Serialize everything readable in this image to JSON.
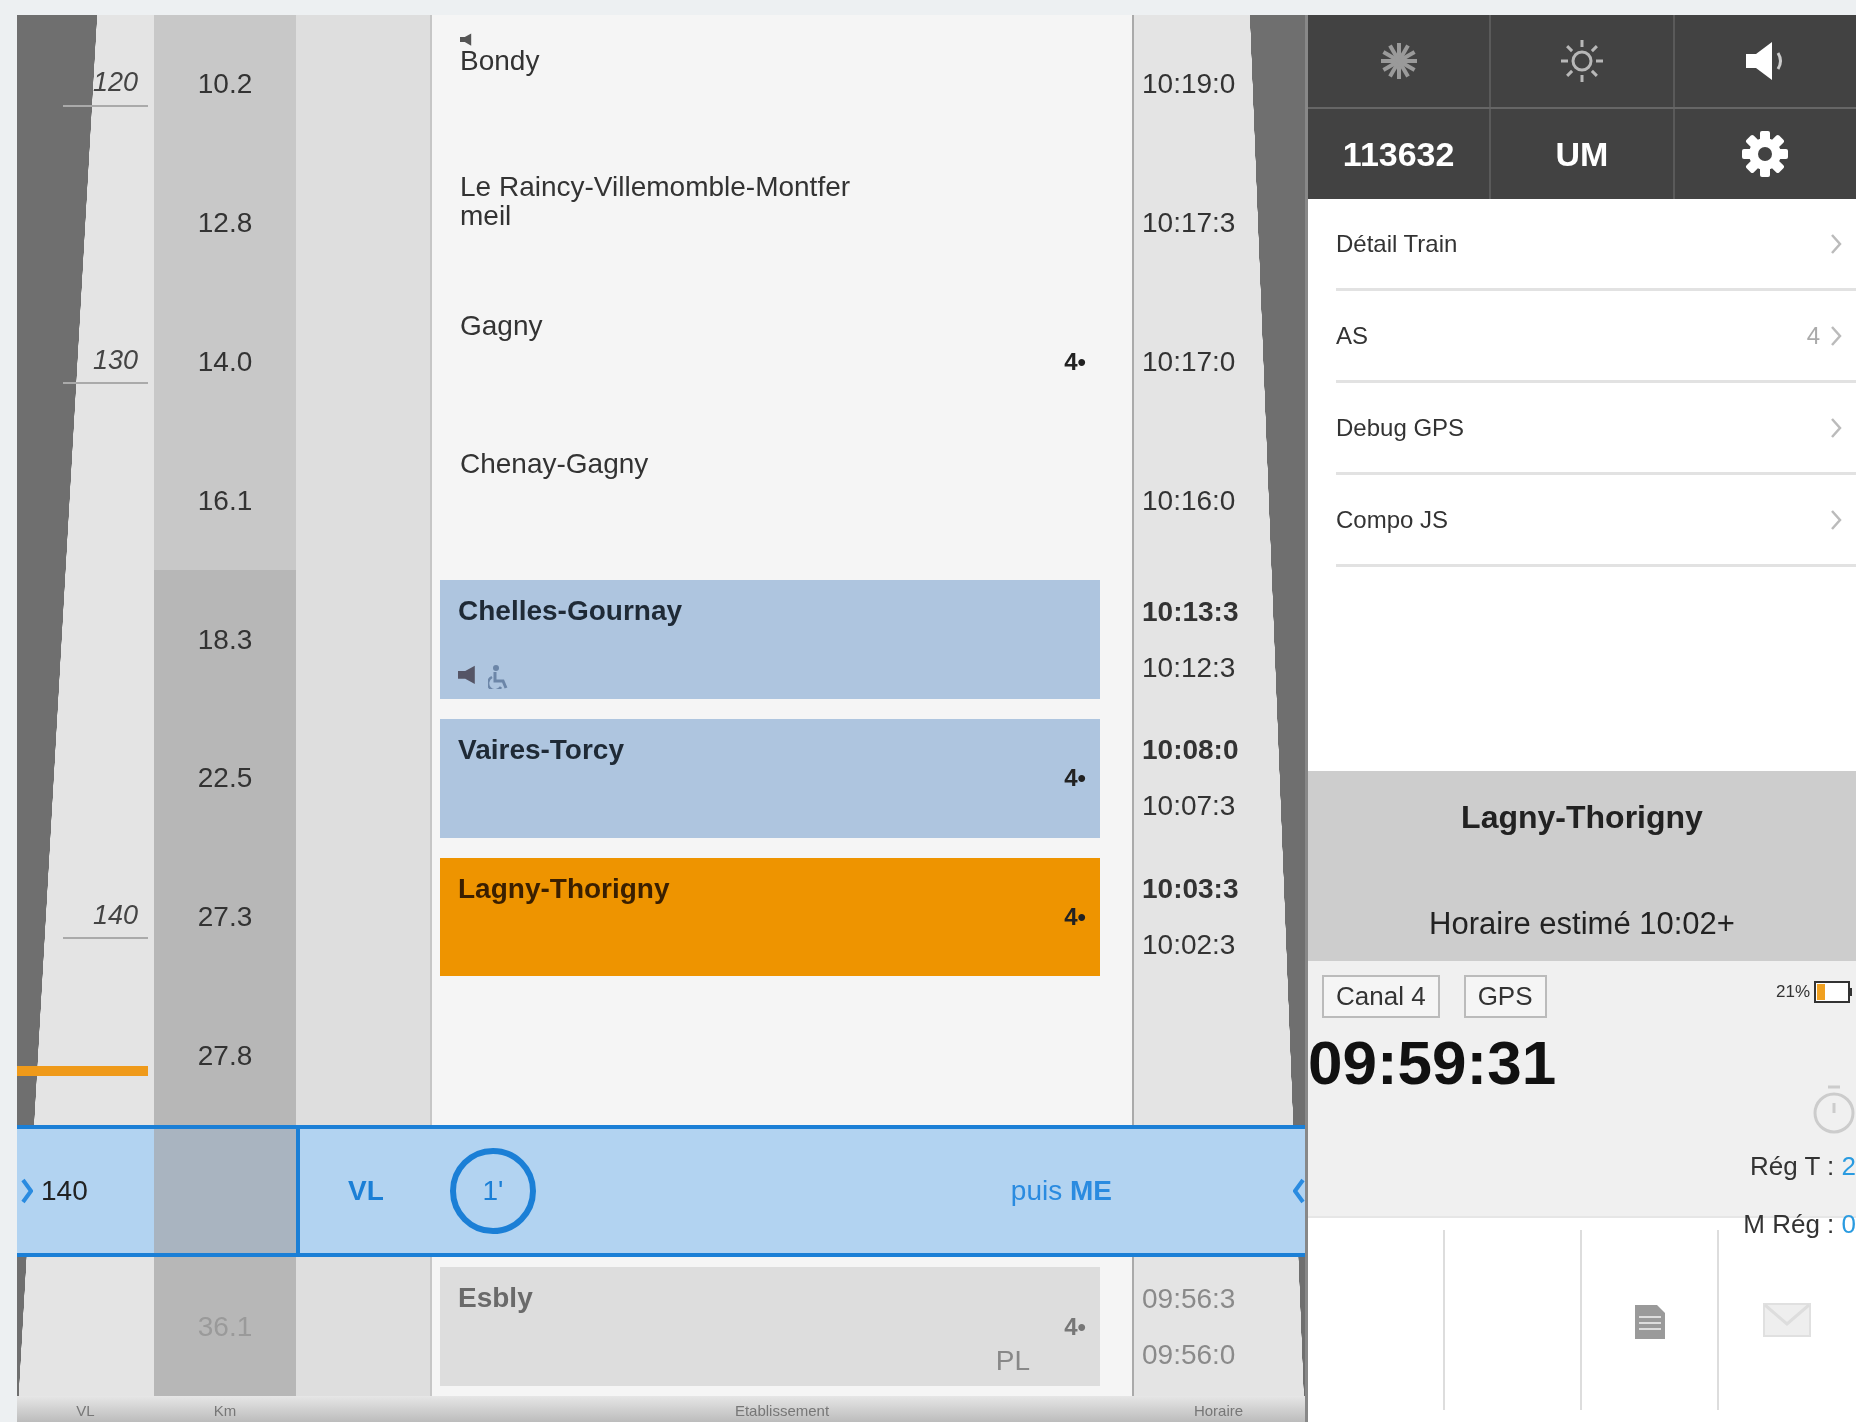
{
  "timeline": {
    "rows": [
      {
        "kind": "waypoint",
        "speed_limit": "120",
        "km": "10.2",
        "station": "Bondy",
        "announce": true,
        "times": [
          "10:19:0"
        ]
      },
      {
        "kind": "waypoint",
        "km": "12.8",
        "station": "Le Raincy-Villemomble-Montfer\nmeil",
        "times": [
          "10:17:3"
        ]
      },
      {
        "kind": "waypoint",
        "speed_limit": "130",
        "km": "14.0",
        "station": "Gagny",
        "track": "4•",
        "times": [
          "10:17:0"
        ]
      },
      {
        "kind": "waypoint",
        "km": "16.1",
        "station": "Chenay-Gagny",
        "times": [
          "10:16:0"
        ]
      },
      {
        "kind": "halt",
        "km": "18.3",
        "station": "Chelles-Gournay",
        "announce": true,
        "wheelchair": true,
        "times": [
          "10:13:3",
          "10:12:3"
        ]
      },
      {
        "kind": "halt",
        "km": "22.5",
        "station": "Vaires-Torcy",
        "track": "4•",
        "times": [
          "10:08:0",
          "10:07:3"
        ]
      },
      {
        "kind": "next_halt",
        "speed_limit": "140",
        "km": "27.3",
        "station": "Lagny-Thorigny",
        "track": "4•",
        "times": [
          "10:03:3",
          "10:02:3"
        ]
      },
      {
        "kind": "km",
        "km": "27.8"
      },
      {
        "kind": "position",
        "speed_limit": "140",
        "vmal": "VL",
        "minutes": "1'",
        "next": "puis **ME**"
      },
      {
        "kind": "later_halt",
        "km": "36.1",
        "station": "Esbly",
        "track": "4•",
        "platform": "PL",
        "times": [
          "09:56:3",
          "09:56:0"
        ]
      }
    ],
    "columns": [
      "VL",
      "Km",
      "",
      "Etablissement",
      "Horaire"
    ]
  },
  "panel": {
    "train_number": "113632",
    "mode": "UM",
    "menu": [
      {
        "label": "Détail Train"
      },
      {
        "label": "AS",
        "value": "4"
      },
      {
        "label": "Debug GPS"
      },
      {
        "label": "Compo JS"
      }
    ],
    "next_stop": {
      "name": "Lagny-Thorigny",
      "estimate": "Horaire estimé 10:02+"
    },
    "status": {
      "badges": [
        "Canal 4",
        "GPS"
      ],
      "battery": "21%",
      "clock": "09:59:31",
      "readings": [
        {
          "label": "Rég T :",
          "value": "2"
        },
        {
          "label": "M Rég :",
          "value": "0"
        }
      ]
    }
  }
}
